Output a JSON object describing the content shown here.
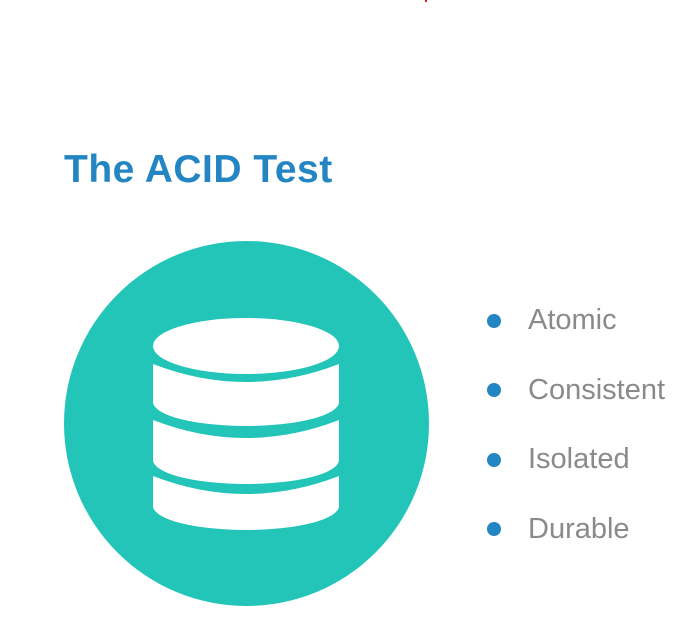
{
  "slide": {
    "title": "The ACID Test",
    "icon": "database-icon",
    "colors": {
      "title": "#2485c3",
      "circle": "#22c5b8",
      "bullet": "#2485c3",
      "bullet_text": "#8a8a8a"
    },
    "bullets": [
      {
        "label": "Atomic"
      },
      {
        "label": "Consistent"
      },
      {
        "label": "Isolated"
      },
      {
        "label": "Durable"
      }
    ]
  }
}
